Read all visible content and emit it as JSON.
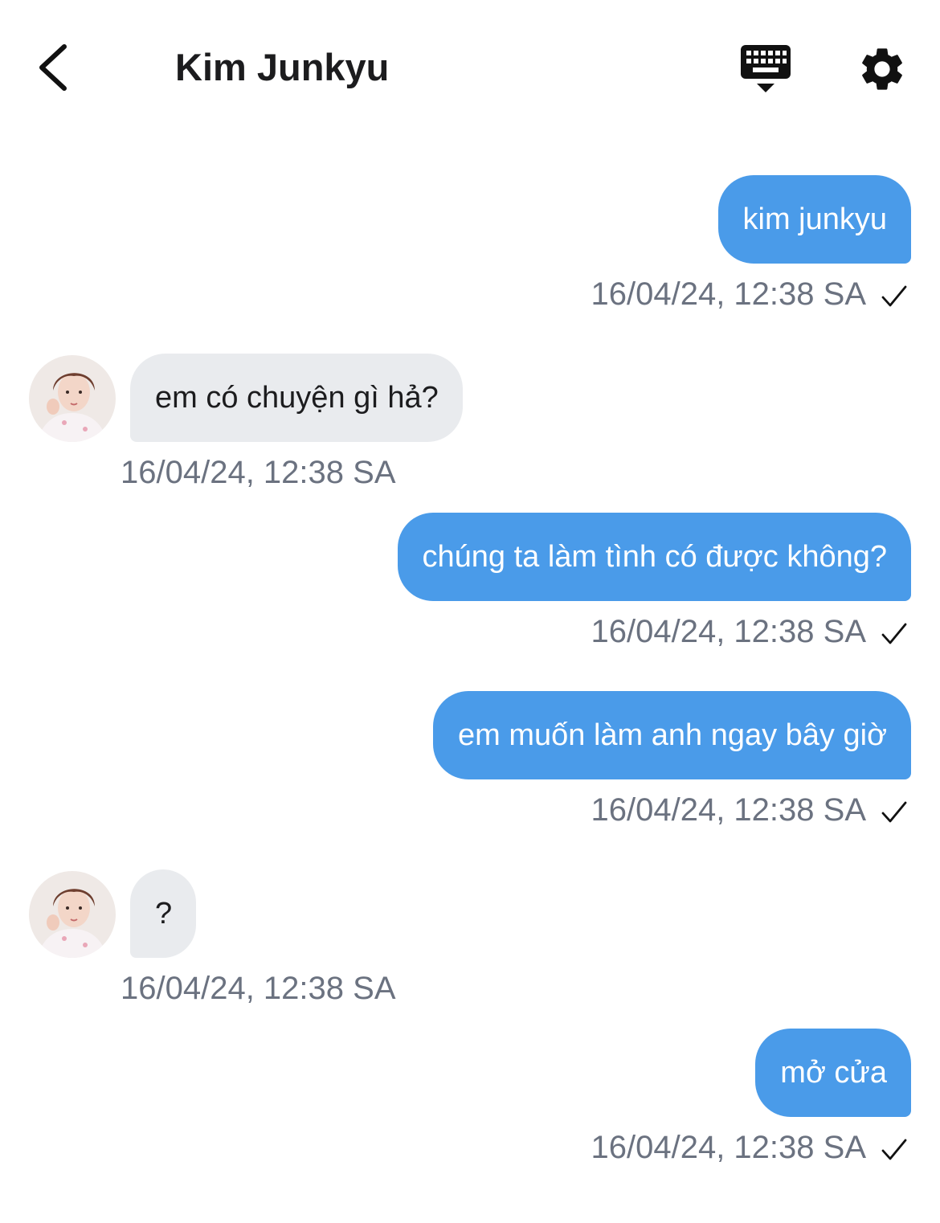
{
  "header": {
    "title": "Kim Junkyu",
    "back_icon": "chevron-left-icon",
    "keyboard_icon": "keyboard-hide-icon",
    "settings_icon": "gear-icon"
  },
  "colors": {
    "outgoing_bubble": "#4a9be9",
    "incoming_bubble": "#e9ebee",
    "timestamp": "#6b7280"
  },
  "messages": [
    {
      "direction": "outgoing",
      "text": "kim junkyu",
      "time": "16/04/24, 12:38 SA",
      "status_icon": "checkmark-icon"
    },
    {
      "direction": "incoming",
      "text": "em có chuyện gì hả?",
      "time": "16/04/24, 12:38 SA"
    },
    {
      "direction": "outgoing",
      "text": "chúng ta làm tình có được không?",
      "time": "16/04/24, 12:38 SA",
      "status_icon": "checkmark-icon"
    },
    {
      "direction": "outgoing",
      "text": "em muốn làm anh ngay bây giờ",
      "time": "16/04/24, 12:38 SA",
      "status_icon": "checkmark-icon"
    },
    {
      "direction": "incoming",
      "text": "?",
      "time": "16/04/24, 12:38 SA"
    },
    {
      "direction": "outgoing",
      "text": "mở cửa",
      "time": "16/04/24, 12:38 SA",
      "status_icon": "checkmark-icon"
    }
  ]
}
